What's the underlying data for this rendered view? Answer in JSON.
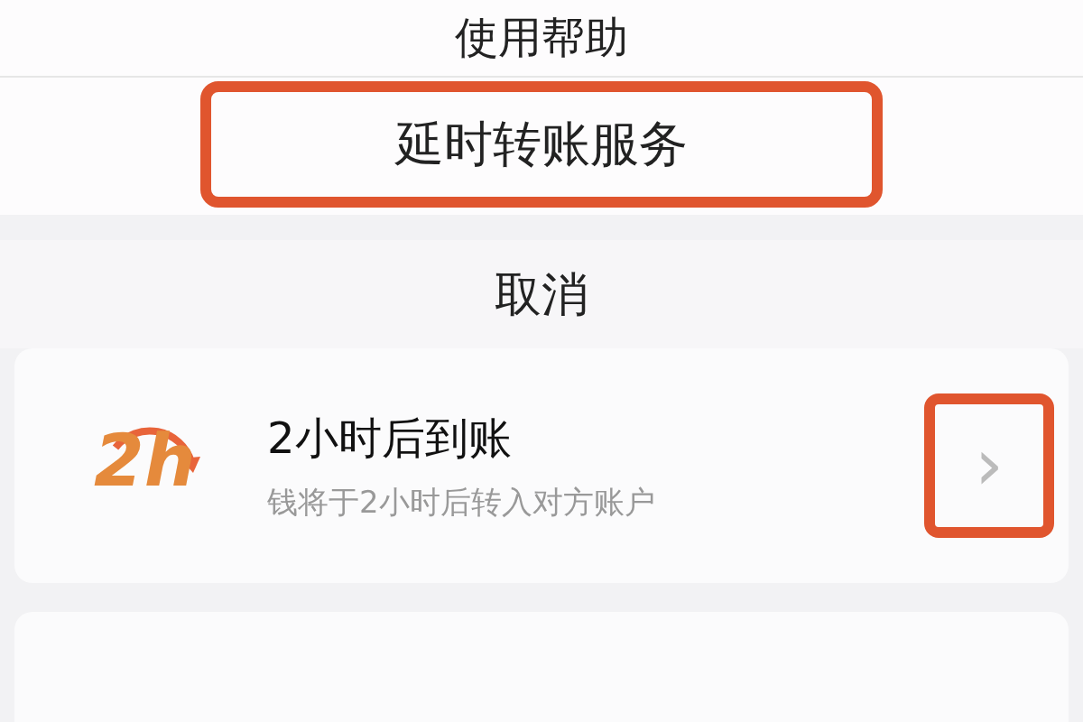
{
  "sheet_items": [
    {
      "label": "使用帮助",
      "highlighted": false
    },
    {
      "label": "延时转账服务",
      "highlighted": true
    }
  ],
  "cancel": "取消",
  "options": [
    {
      "badge": "2h",
      "title": "2小时后到账",
      "subtitle": "钱将于2小时后转入对方账户",
      "chevron": "›",
      "chevron_highlighted": true
    }
  ]
}
